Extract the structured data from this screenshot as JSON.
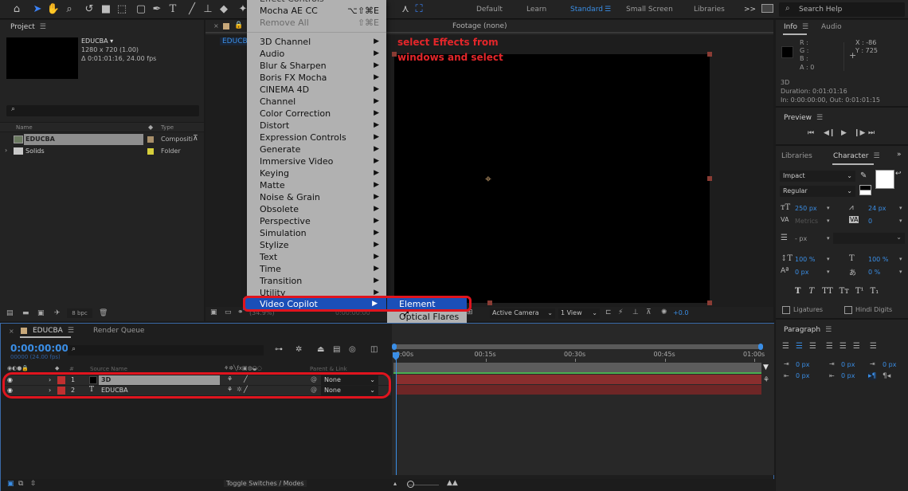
{
  "toolbar": {
    "tools": [
      "home-icon",
      "selection-tool-icon",
      "hand-tool-icon",
      "zoom-tool-icon",
      "rotate-tool-icon",
      "camera-tool-icon",
      "pan-behind-tool-icon",
      "rectangle-tool-icon",
      "pen-tool-icon",
      "type-tool-icon",
      "brush-tool-icon",
      "clone-stamp-tool-icon",
      "eraser-tool-icon",
      "puppet-tool-icon"
    ],
    "workspaces": [
      "Default",
      "Learn",
      "Standard",
      "Small Screen",
      "Libraries"
    ],
    "active_workspace": "Standard",
    "more_label": ">>",
    "search_placeholder": "Search Help"
  },
  "project": {
    "title": "Project",
    "comp_name": "EDUCBA ▾",
    "comp_size": "1280 x 720 (1.00)",
    "comp_duration": "Δ 0:01:01:16, 24.00 fps",
    "search_placeholder": "",
    "columns": {
      "name": "Name",
      "type": "Type"
    },
    "items": [
      {
        "name": "EDUCBA",
        "type": "Compositi",
        "swatch": "#a88f6a",
        "selected": true
      },
      {
        "name": "Solids",
        "type": "Folder",
        "swatch": "#d6cf3b",
        "selected": false
      }
    ],
    "bpc": "8 bpc"
  },
  "composition": {
    "tab_label": "EDUCBA",
    "footage_label": "Footage (none)",
    "zoom_level": "(34.9%)",
    "timecode": "0:00:00:00",
    "camera": "Active Camera",
    "views": "1 View",
    "exposure": "+0.0"
  },
  "menu": {
    "top_partial": "Effect Controls",
    "items_top": [
      {
        "label": "Mocha AE CC",
        "shortcut": "⌥⇧⌘E",
        "disabled": false
      },
      {
        "label": "Remove All",
        "shortcut": "⇧⌘E",
        "disabled": true
      }
    ],
    "categories": [
      "3D Channel",
      "Audio",
      "Blur & Sharpen",
      "Boris FX Mocha",
      "CINEMA 4D",
      "Channel",
      "Color Correction",
      "Distort",
      "Expression Controls",
      "Generate",
      "Immersive Video",
      "Keying",
      "Matte",
      "Noise & Grain",
      "Obsolete",
      "Perspective",
      "Simulation",
      "Stylize",
      "Text",
      "Time",
      "Transition",
      "Utility"
    ],
    "highlighted": "Video Copilot",
    "submenu": [
      "Element",
      "Optical Flares"
    ],
    "submenu_highlighted": "Element"
  },
  "annotation": {
    "line1": "select Effects from",
    "line2": "windows and select"
  },
  "info": {
    "tabs": [
      "Info",
      "Audio"
    ],
    "r": "R :",
    "g": "G :",
    "b": "B :",
    "a": "A :  0",
    "x": "X : -86",
    "y": "Y : 725",
    "layer": "3D",
    "duration": "Duration: 0:01:01:16",
    "inout": "In: 0:00:00:00, Out: 0:01:01:15"
  },
  "preview": {
    "title": "Preview"
  },
  "character": {
    "tabs": [
      "Libraries",
      "Character"
    ],
    "font": "Impact",
    "style": "Regular",
    "size": "250 px",
    "leading": "24 px",
    "kerning": "Metrics",
    "tracking": "0",
    "stroke": "- px",
    "vscale": "100 %",
    "hscale": "100 %",
    "baseline": "0 px",
    "tsume": "0 %",
    "ligatures": "Ligatures",
    "hindi_digits": "Hindi Digits"
  },
  "paragraph": {
    "title": "Paragraph",
    "indent_left": "0 px",
    "indent_first": "0 px",
    "space_before": "0 px",
    "indent_right": "0 px",
    "space_after": "0 px"
  },
  "timeline": {
    "tab": "EDUCBA",
    "render_queue": "Render Queue",
    "timecode": "0:00:00:00",
    "frames": "00000 (24.00 fps)",
    "col_source": "Source Name",
    "col_parent": "Parent & Link",
    "col_num": "#",
    "ticks": [
      "0:00s",
      "00:15s",
      "00:30s",
      "00:45s",
      "01:00s"
    ],
    "layers": [
      {
        "num": "1",
        "name": "3D",
        "parent": "None",
        "type": "solid"
      },
      {
        "num": "2",
        "name": "EDUCBA",
        "parent": "None",
        "type": "text"
      }
    ],
    "toggle_label": "Toggle Switches / Modes"
  }
}
